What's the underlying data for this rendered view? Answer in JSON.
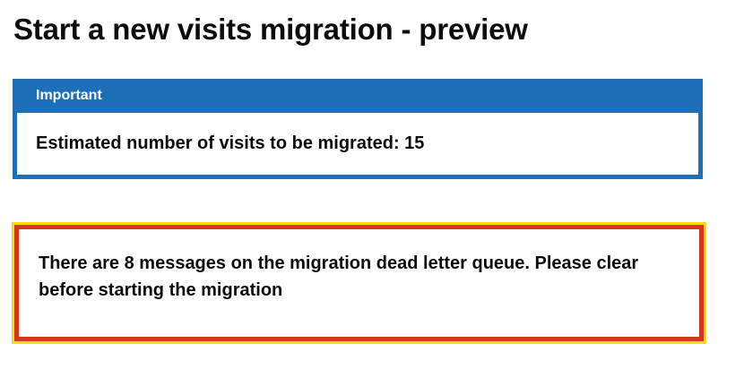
{
  "page": {
    "title": "Start a new visits migration - preview"
  },
  "notification_banner": {
    "header": "Important",
    "message": "Estimated number of visits to be migrated: 15"
  },
  "error_summary": {
    "message": "There are 8 messages on the migration dead letter queue. Please clear before starting the migration"
  },
  "colors": {
    "banner_blue": "#1d70b8",
    "error_red": "#d4351c",
    "focus_yellow": "#ffdd00",
    "text": "#0b0c0c"
  }
}
